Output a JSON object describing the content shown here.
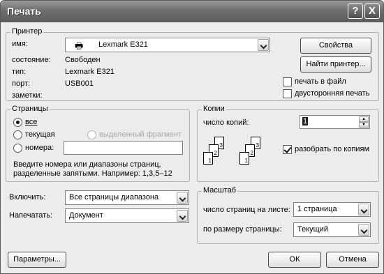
{
  "window": {
    "title": "Печать",
    "help_icon": "?",
    "close_icon": "X"
  },
  "printer": {
    "group_label": "Принтер",
    "name_label": "имя:",
    "name_value": "Lexmark E321",
    "status_label": "состояние:",
    "status_value": "Свободен",
    "type_label": "тип:",
    "type_value": "Lexmark E321",
    "port_label": "порт:",
    "port_value": "USB001",
    "notes_label": "заметки:",
    "properties_button": "Свойства",
    "find_printer_button": "Найти принтер...",
    "print_to_file_label": "печать в файл",
    "print_to_file_checked": false,
    "duplex_label": "двусторонняя печать",
    "duplex_checked": false
  },
  "pages": {
    "group_label": "Страницы",
    "all_label": "все",
    "current_label": "текущая",
    "selection_label": "выделенный фрагмент",
    "numbers_label": "номера:",
    "numbers_value": "",
    "selected": "all",
    "hint": "Введите номера или диапазоны страниц,",
    "hint2": "разделенные запятыми. Например: 1,3,5–12"
  },
  "copies": {
    "group_label": "Копии",
    "count_label": "число копий:",
    "count_value": "1",
    "collate_label": "разобрать по копиям",
    "collate_checked": true,
    "page_labels": [
      "1",
      "2",
      "3"
    ]
  },
  "include": {
    "label": "Включить:",
    "value": "Все страницы диапазона"
  },
  "print_what": {
    "label": "Напечатать:",
    "value": "Документ"
  },
  "zoom": {
    "group_label": "Масштаб",
    "pages_per_sheet_label": "число страниц на листе:",
    "pages_per_sheet_value": "1 страница",
    "scale_to_paper_label": "по размеру страницы:",
    "scale_to_paper_value": "Текущий"
  },
  "footer": {
    "options_button": "Параметры...",
    "ok_button": "ОК",
    "cancel_button": "Отмена"
  }
}
